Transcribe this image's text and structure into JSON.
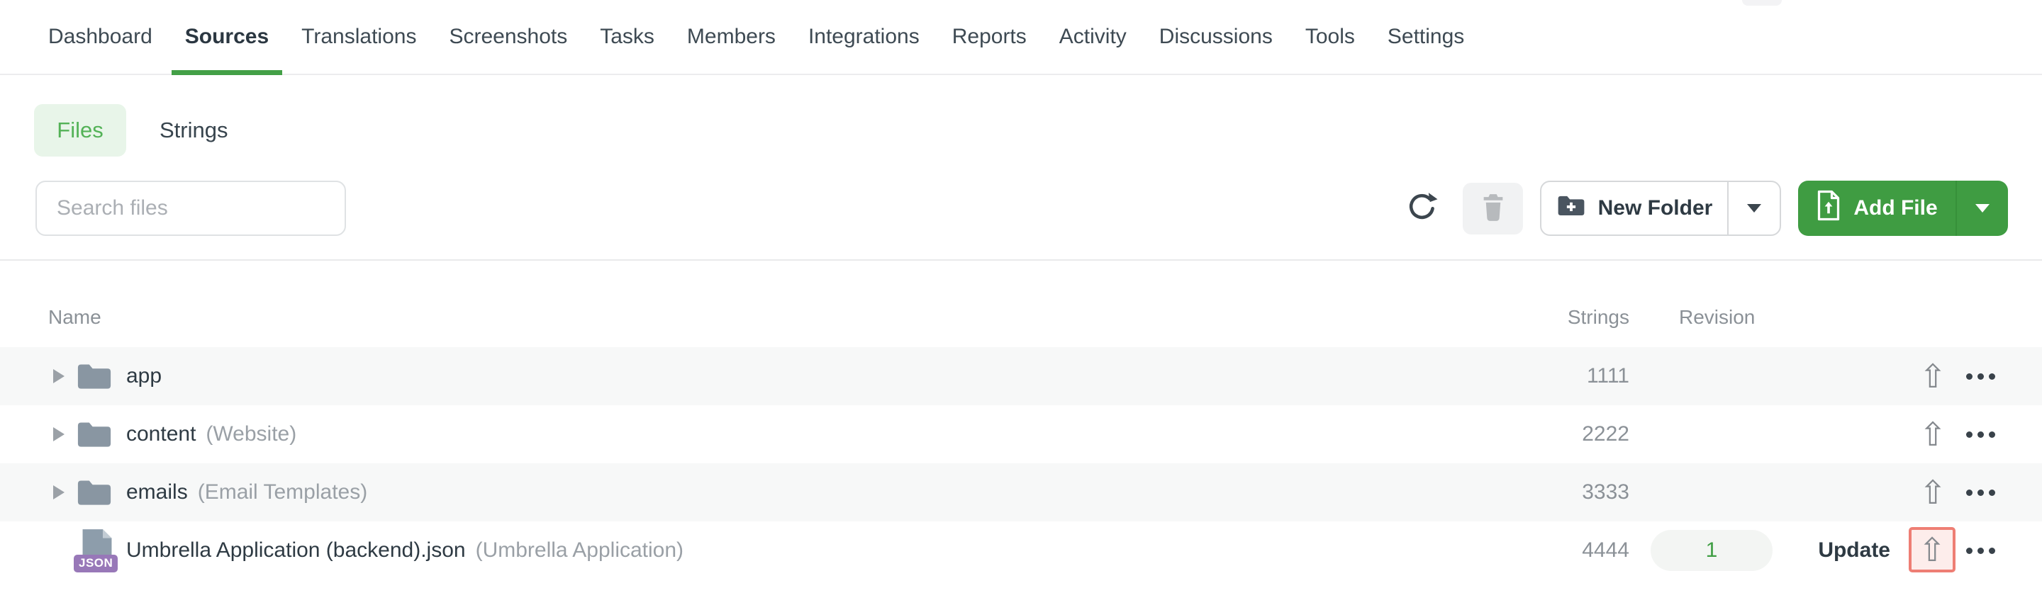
{
  "nav": {
    "active": "Sources",
    "items": [
      {
        "label": "Dashboard"
      },
      {
        "label": "Sources"
      },
      {
        "label": "Translations"
      },
      {
        "label": "Screenshots"
      },
      {
        "label": "Tasks"
      },
      {
        "label": "Members"
      },
      {
        "label": "Integrations"
      },
      {
        "label": "Reports"
      },
      {
        "label": "Activity"
      },
      {
        "label": "Discussions"
      },
      {
        "label": "Tools"
      },
      {
        "label": "Settings"
      }
    ]
  },
  "view_tabs": {
    "files_label": "Files",
    "strings_label": "Strings"
  },
  "toolbar": {
    "search_placeholder": "Search files",
    "new_folder_label": "New Folder",
    "add_file_label": "Add File"
  },
  "table": {
    "headers": {
      "name": "Name",
      "strings": "Strings",
      "revision": "Revision"
    },
    "rows": [
      {
        "type": "folder",
        "name": "app",
        "title": "",
        "strings": "1111"
      },
      {
        "type": "folder",
        "name": "content",
        "title": "(Website)",
        "strings": "2222"
      },
      {
        "type": "folder",
        "name": "emails",
        "title": "(Email Templates)",
        "strings": "3333"
      },
      {
        "type": "file",
        "name": "Umbrella Application (backend).json",
        "title": "(Umbrella Application)",
        "strings": "4444",
        "revision": "1",
        "update_label": "Update",
        "file_badge": "JSON"
      }
    ]
  },
  "colors": {
    "accent_green": "#3f9c42",
    "active_tab_underline": "#43a047",
    "files_pill_bg": "#e8f5e9",
    "files_pill_text": "#53b257",
    "revision_text": "#3f9e43",
    "highlight_border": "#ee7e74",
    "highlight_bg": "#fdedeb",
    "stripe_bg": "#f7f8f8"
  }
}
